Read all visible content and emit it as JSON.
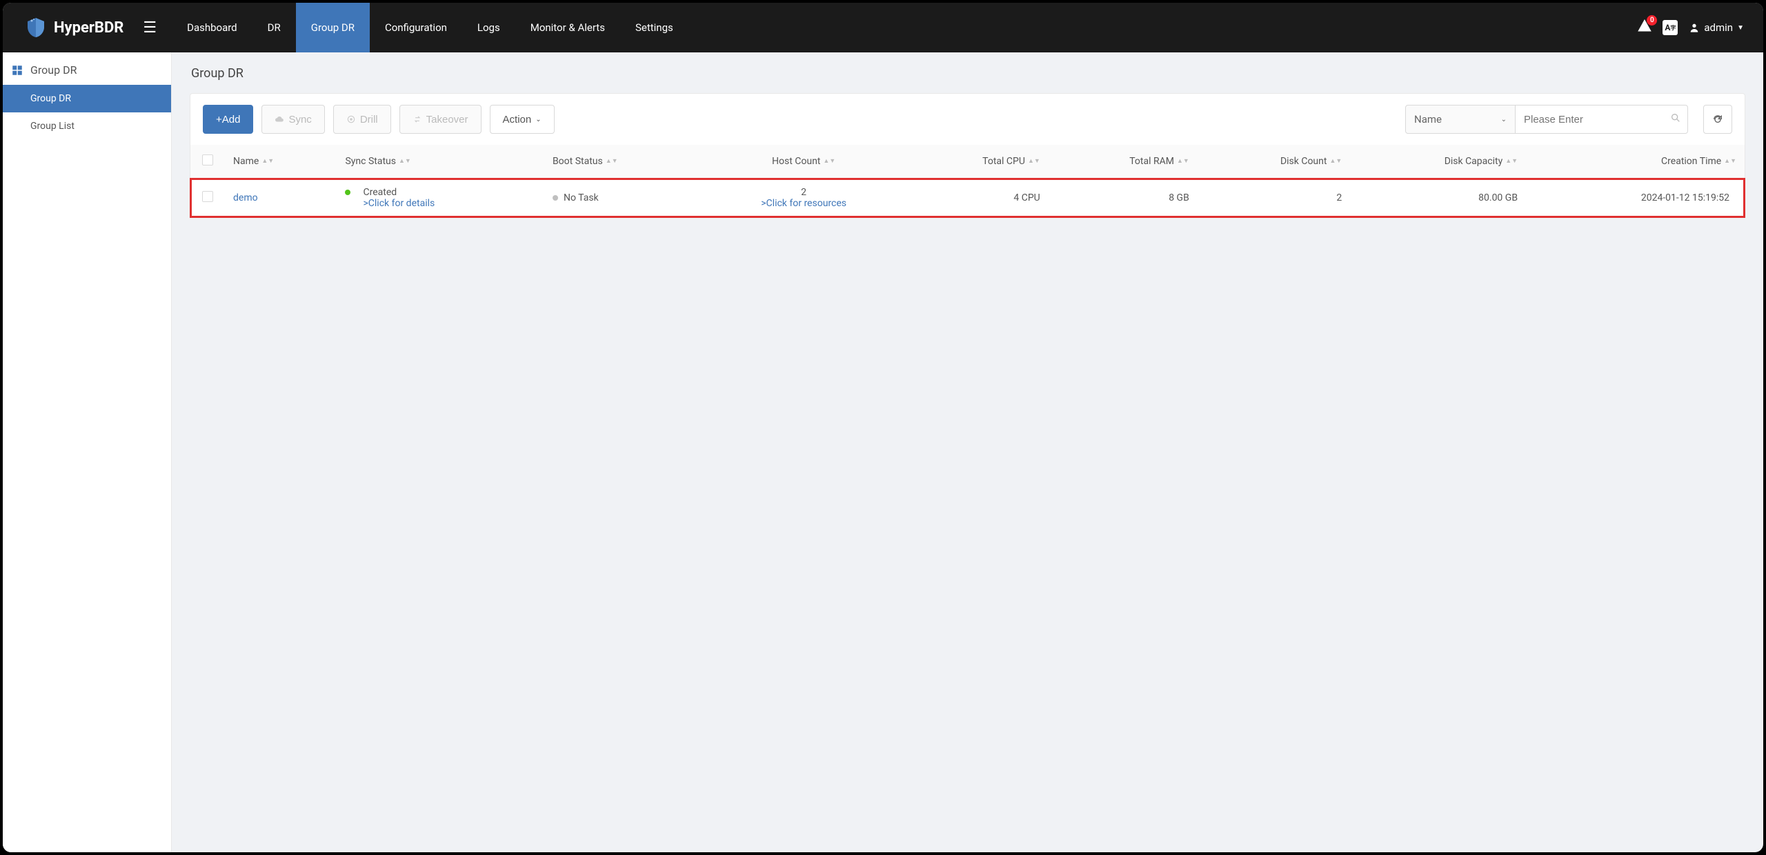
{
  "brand": {
    "name": "HyperBDR"
  },
  "nav": {
    "items": [
      {
        "label": "Dashboard",
        "active": false
      },
      {
        "label": "DR",
        "active": false
      },
      {
        "label": "Group DR",
        "active": true
      },
      {
        "label": "Configuration",
        "active": false
      },
      {
        "label": "Logs",
        "active": false
      },
      {
        "label": "Monitor & Alerts",
        "active": false
      },
      {
        "label": "Settings",
        "active": false
      }
    ],
    "alert_count": "0",
    "lang": "A",
    "user": "admin"
  },
  "sidebar": {
    "heading": "Group DR",
    "items": [
      {
        "label": "Group DR",
        "active": true
      },
      {
        "label": "Group List",
        "active": false
      }
    ]
  },
  "page": {
    "title": "Group DR"
  },
  "toolbar": {
    "add": "+Add",
    "sync": "Sync",
    "drill": "Drill",
    "takeover": "Takeover",
    "action": "Action",
    "filter_field": "Name",
    "search_placeholder": "Please Enter"
  },
  "table": {
    "columns": {
      "name": "Name",
      "sync_status": "Sync Status",
      "boot_status": "Boot Status",
      "host_count": "Host Count",
      "total_cpu": "Total CPU",
      "total_ram": "Total RAM",
      "disk_count": "Disk Count",
      "disk_capacity": "Disk Capacity",
      "creation_time": "Creation Time"
    },
    "rows": [
      {
        "name": "demo",
        "sync_status": "Created",
        "sync_link": ">Click for details",
        "boot_status": "No Task",
        "host_count": "2",
        "host_link": ">Click for resources",
        "total_cpu": "4 CPU",
        "total_ram": "8 GB",
        "disk_count": "2",
        "disk_capacity": "80.00 GB",
        "creation_time": "2024-01-12 15:19:52"
      }
    ]
  }
}
